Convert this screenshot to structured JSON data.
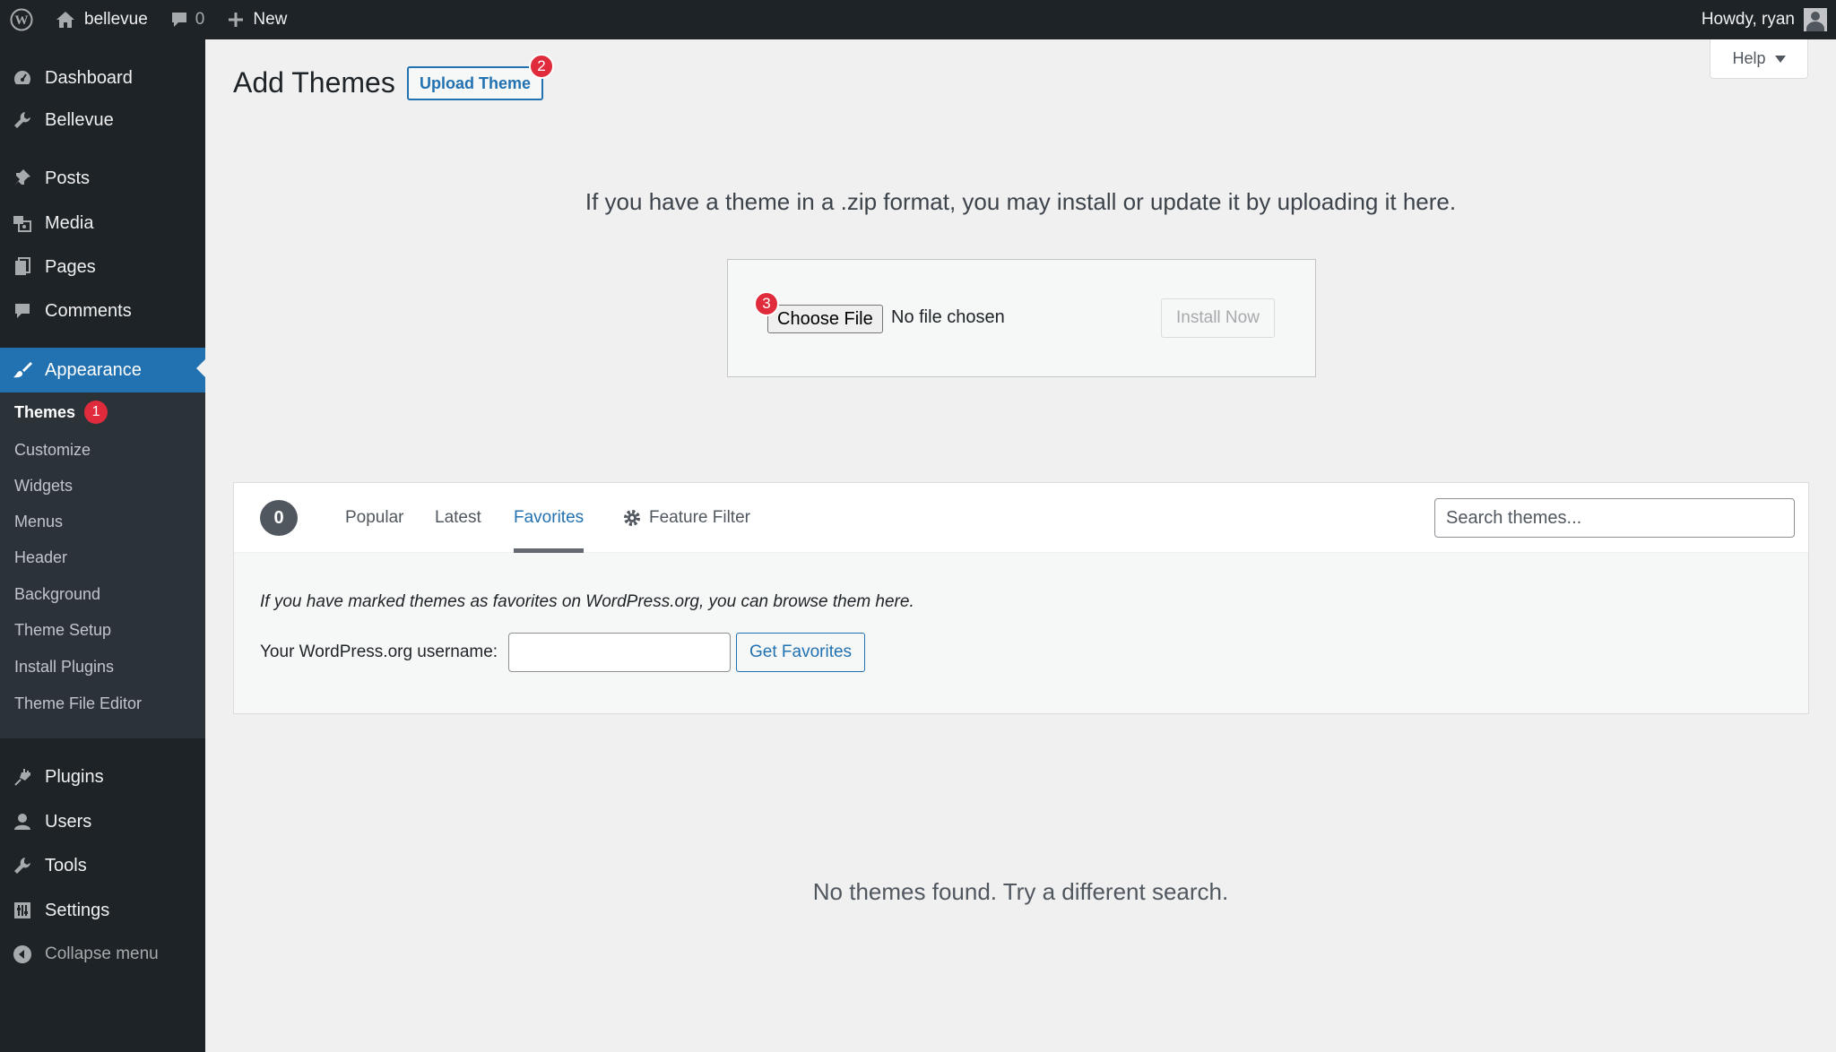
{
  "admin_bar": {
    "site_name": "bellevue",
    "comments_count": "0",
    "new_label": "New",
    "greeting": "Howdy, ryan"
  },
  "sidebar": {
    "items": [
      {
        "label": "Dashboard",
        "icon": "dashboard-icon"
      },
      {
        "label": "Bellevue",
        "icon": "wrench-icon"
      },
      {
        "label": "Posts",
        "icon": "pin-icon"
      },
      {
        "label": "Media",
        "icon": "media-icon"
      },
      {
        "label": "Pages",
        "icon": "pages-icon"
      },
      {
        "label": "Comments",
        "icon": "comments-icon"
      },
      {
        "label": "Appearance",
        "icon": "brush-icon"
      },
      {
        "label": "Plugins",
        "icon": "plugin-icon"
      },
      {
        "label": "Users",
        "icon": "user-icon"
      },
      {
        "label": "Tools",
        "icon": "tools-icon"
      },
      {
        "label": "Settings",
        "icon": "settings-icon"
      }
    ],
    "submenu": [
      {
        "label": "Themes",
        "badge": "1"
      },
      {
        "label": "Customize"
      },
      {
        "label": "Widgets"
      },
      {
        "label": "Menus"
      },
      {
        "label": "Header"
      },
      {
        "label": "Background"
      },
      {
        "label": "Theme Setup"
      },
      {
        "label": "Install Plugins"
      },
      {
        "label": "Theme File Editor"
      }
    ],
    "collapse_label": "Collapse menu"
  },
  "header": {
    "title": "Add Themes",
    "upload_button": "Upload Theme",
    "upload_badge": "2",
    "help_label": "Help"
  },
  "upload": {
    "description": "If you have a theme in a .zip format, you may install or update it by uploading it here.",
    "choose_file": "Choose File",
    "choose_badge": "3",
    "no_file": "No file chosen",
    "install_button": "Install Now"
  },
  "filter": {
    "count": "0",
    "tabs": [
      "Popular",
      "Latest",
      "Favorites"
    ],
    "active_tab": "Favorites",
    "feature_filter": "Feature Filter",
    "search_placeholder": "Search themes..."
  },
  "favorites": {
    "description": "If you have marked themes as favorites on WordPress.org, you can browse them here.",
    "username_label": "Your WordPress.org username:",
    "username_value": "",
    "button": "Get Favorites"
  },
  "empty_message": "No themes found. Try a different search.",
  "colors": {
    "sidebar_bg": "#1d2327",
    "accent": "#2271b1",
    "badge": "#e02b3c",
    "content_bg": "#f0f0f1"
  }
}
